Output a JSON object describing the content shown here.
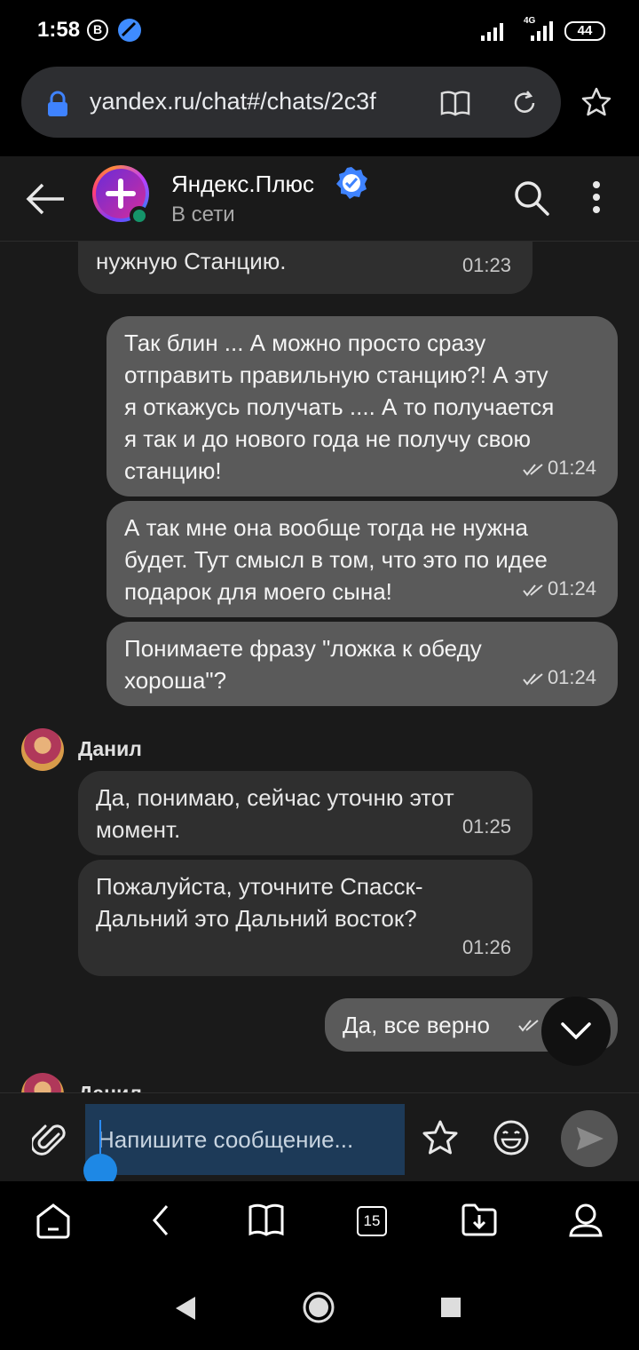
{
  "status_bar": {
    "time": "1:58",
    "b_badge": "B",
    "network": "4G",
    "battery": "44"
  },
  "browser": {
    "url": "yandex.ru/chat#/chats/2c3f",
    "open_tabs": "15"
  },
  "chat": {
    "name": "Яндекс.Плюс",
    "status": "В сети",
    "accent_color": "#2a8cff",
    "verified_color": "#3f83ff"
  },
  "messages": [
    {
      "direction": "in",
      "lines": [
        "нужную Станцию."
      ],
      "time": "01:23"
    },
    {
      "direction": "out",
      "lines": [
        "Так блин ... А можно просто сразу",
        "отправить правильную станцию?! А эту",
        "я откажусь получать .... А то получается",
        "я так и до нового года не получу свою",
        "станцию!"
      ],
      "time": "01:24"
    },
    {
      "direction": "out",
      "lines": [
        "А так мне она вообще тогда не нужна",
        "будет. Тут смысл в том, что это по идее",
        "подарок для моего сына!"
      ],
      "time": "01:24"
    },
    {
      "direction": "out",
      "lines": [
        "Понимаете фразу \"ложка к обеду",
        "хороша\"?"
      ],
      "time": "01:24"
    },
    {
      "direction": "in",
      "sender": "Данил",
      "lines": [
        "Да, понимаю, сейчас уточню этот",
        "момент."
      ],
      "time": "01:25"
    },
    {
      "direction": "in",
      "lines": [
        "Пожалуйста, уточните Спасск-",
        "Дальний это Дальний восток?"
      ],
      "time": "01:26"
    },
    {
      "direction": "out",
      "lines": [
        "Да, все верно"
      ],
      "time": ""
    }
  ],
  "next_sender": "Данил",
  "composer": {
    "placeholder": "Напишите сообщение..."
  }
}
